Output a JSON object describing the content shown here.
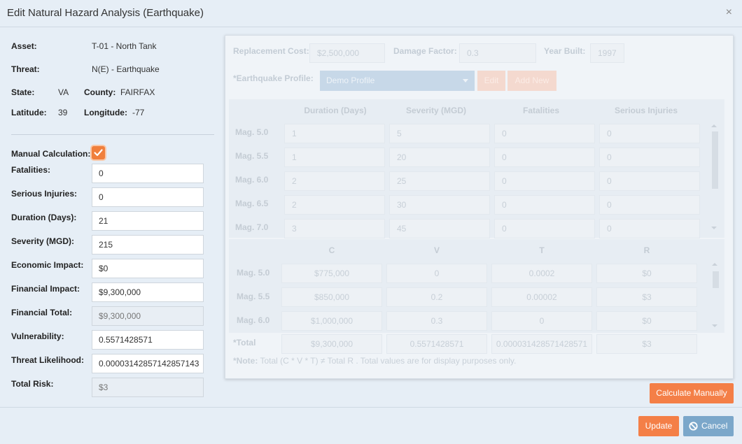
{
  "dialog": {
    "title": "Edit Natural Hazard Analysis (Earthquake)",
    "close_glyph": "×"
  },
  "info": {
    "asset_label": "Asset:",
    "asset_value": "T-01 - North Tank",
    "threat_label": "Threat:",
    "threat_value": "N(E) - Earthquake",
    "state_label": "State:",
    "state_value": "VA",
    "county_label": "County:",
    "county_value": "FAIRFAX",
    "latitude_label": "Latitude:",
    "latitude_value": "39",
    "longitude_label": "Longitude:",
    "longitude_value": "-77"
  },
  "manual": {
    "label": "Manual Calculation:",
    "checked": true
  },
  "fields": [
    {
      "label": "Fatalities:",
      "value": "0",
      "readonly": false
    },
    {
      "label": "Serious Injuries:",
      "value": "0",
      "readonly": false
    },
    {
      "label": "Duration (Days):",
      "value": "21",
      "readonly": false
    },
    {
      "label": "Severity (MGD):",
      "value": "215",
      "readonly": false
    },
    {
      "label": "Economic Impact:",
      "value": "$0",
      "readonly": false
    },
    {
      "label": "Financial Impact:",
      "value": "$9,300,000",
      "readonly": false
    },
    {
      "label": "Financial Total:",
      "value": "$9,300,000",
      "readonly": true
    },
    {
      "label": "Vulnerability:",
      "value": "0.5571428571",
      "readonly": false
    },
    {
      "label": "Threat Likelihood:",
      "value": "0.00003142857142857143",
      "readonly": false
    },
    {
      "label": "Total Risk:",
      "value": "$3",
      "readonly": true
    }
  ],
  "panel": {
    "replacement_cost_label": "Replacement Cost:",
    "replacement_cost_value": "$2,500,000",
    "damage_factor_label": "Damage Factor:",
    "damage_factor_value": "0.3",
    "year_built_label": "Year Built:",
    "year_built_value": "1997",
    "profile_label": "*Earthquake Profile:",
    "profile_value": "Demo Profile",
    "edit_label": "Edit",
    "add_new_label": "Add New",
    "table1": {
      "headers": [
        "Duration (Days)",
        "Severity (MGD)",
        "Fatalities",
        "Serious Injuries"
      ],
      "rows": [
        {
          "label": "Mag. 5.0",
          "cells": [
            "1",
            "5",
            "0",
            "0"
          ]
        },
        {
          "label": "Mag. 5.5",
          "cells": [
            "1",
            "20",
            "0",
            "0"
          ]
        },
        {
          "label": "Mag. 6.0",
          "cells": [
            "2",
            "25",
            "0",
            "0"
          ]
        },
        {
          "label": "Mag. 6.5",
          "cells": [
            "2",
            "30",
            "0",
            "0"
          ]
        },
        {
          "label": "Mag. 7.0",
          "cells": [
            "3",
            "45",
            "0",
            "0"
          ]
        }
      ]
    },
    "table2": {
      "headers": [
        "C",
        "V",
        "T",
        "R"
      ],
      "rows": [
        {
          "label": "Mag. 5.0",
          "cells": [
            "$775,000",
            "0",
            "0.0002",
            "$0"
          ]
        },
        {
          "label": "Mag. 5.5",
          "cells": [
            "$850,000",
            "0.2",
            "0.00002",
            "$3"
          ]
        },
        {
          "label": "Mag. 6.0",
          "cells": [
            "$1,000,000",
            "0.3",
            "0",
            "$0"
          ]
        }
      ],
      "total": {
        "label": "*Total",
        "cells": [
          "$9,300,000",
          "0.5571428571",
          "0.000031428571428571",
          "$3"
        ]
      }
    },
    "note_bold": "*Note:",
    "note_text": " Total (C * V * T) ≠ Total R . Total values are for display purposes only."
  },
  "buttons": {
    "calculate": "Calculate Manually",
    "update": "Update",
    "cancel": "Cancel"
  }
}
